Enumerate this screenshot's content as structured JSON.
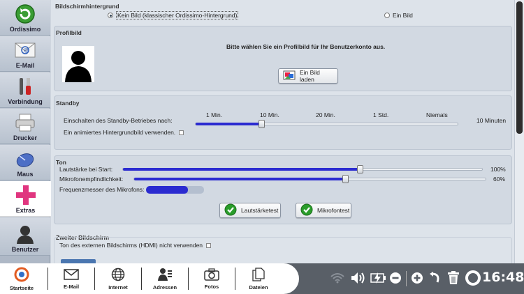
{
  "sidebar": {
    "items": [
      {
        "label": "Ordissimo"
      },
      {
        "label": "E-Mail"
      },
      {
        "label": "Verbindung"
      },
      {
        "label": "Drucker"
      },
      {
        "label": "Maus"
      },
      {
        "label": "Extras"
      },
      {
        "label": "Benutzer"
      }
    ],
    "active": "Extras"
  },
  "background": {
    "title": "Bildschirmhintergrund",
    "option_none": "Kein Bild (klassischer Ordissimo-Hintergrund)",
    "option_image": "Ein Bild",
    "selected": "Kein Bild (klassischer Ordissimo-Hintergrund)"
  },
  "profile": {
    "title": "Profilbild",
    "prompt": "Bitte wählen Sie ein Profilbild für Ihr Benutzerkonto aus.",
    "load_button": "Ein Bild laden"
  },
  "standby": {
    "title": "Standby",
    "activate_label": "Einschalten des Standby-Betriebes nach:",
    "ticks": [
      "1 Min.",
      "10 Min.",
      "20 Min.",
      "1 Std.",
      "Niemals"
    ],
    "value_text": "10 Minuten",
    "value_fraction": 0.25,
    "animated_label": "Ein animiertes Hintergrundbild verwenden.",
    "animated_checked": false
  },
  "sound": {
    "title": "Ton",
    "volume_label": "Lautstärke bei Start:",
    "volume_value": "100%",
    "volume_fraction": 0.66,
    "mic_label": "Mikrofonempfindlichkeit:",
    "mic_value": "60%",
    "mic_fraction": 0.6,
    "meter_label": "Frequenzmesser des Mikrofons:",
    "meter_fraction": 0.72,
    "volume_test_button": "Lautstärketest",
    "mic_test_button": "Mikrofontest"
  },
  "second_screen": {
    "title": "Zweiter Bildschirm",
    "hdmi_label": "Ton des externen Bildschirms (HDMI) nicht verwenden",
    "hdmi_checked": false
  },
  "taskbar": {
    "items": [
      {
        "label": "Startseite"
      },
      {
        "label": "E-Mail"
      },
      {
        "label": "Internet"
      },
      {
        "label": "Adressen"
      },
      {
        "label": "Fotos"
      },
      {
        "label": "Dateien"
      }
    ],
    "time": "16:48"
  },
  "colors": {
    "slider_fill": "#2b2bd0",
    "accent_green": "#2a9d2a",
    "extras_pink": "#e0357f"
  }
}
